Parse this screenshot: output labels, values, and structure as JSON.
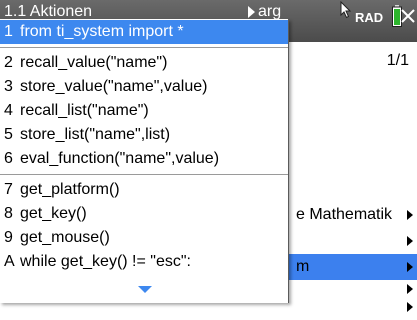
{
  "statusbar": {
    "tab_title": "1.1 Aktionen",
    "next_tab_partial": "arg",
    "angle_mode": "RAD",
    "icons": [
      "cursor-icon",
      "battery-icon",
      "close-icon"
    ]
  },
  "document": {
    "page_count": "1/1",
    "rows": [
      {
        "label": "e Mathematik"
      },
      {
        "label": ""
      },
      {
        "label": "m"
      },
      {
        "label": ""
      },
      {
        "label": ""
      }
    ]
  },
  "menu": {
    "items": [
      {
        "key": "1",
        "label": "from ti_system import *"
      },
      {
        "key": "2",
        "label": "recall_value(\"name\")"
      },
      {
        "key": "3",
        "label": "store_value(\"name\",value)"
      },
      {
        "key": "4",
        "label": "recall_list(\"name\")"
      },
      {
        "key": "5",
        "label": "store_list(\"name\",list)"
      },
      {
        "key": "6",
        "label": "eval_function(\"name\",value)"
      },
      {
        "key": "7",
        "label": "get_platform()"
      },
      {
        "key": "8",
        "label": "get_key()"
      },
      {
        "key": "9",
        "label": "get_mouse()"
      },
      {
        "key": "A",
        "label": "while get_key() != \"esc\":"
      }
    ]
  },
  "colors": {
    "statusbar": "#4b4b4b",
    "highlight": "#3d88ef",
    "battery": "#2db52d"
  }
}
